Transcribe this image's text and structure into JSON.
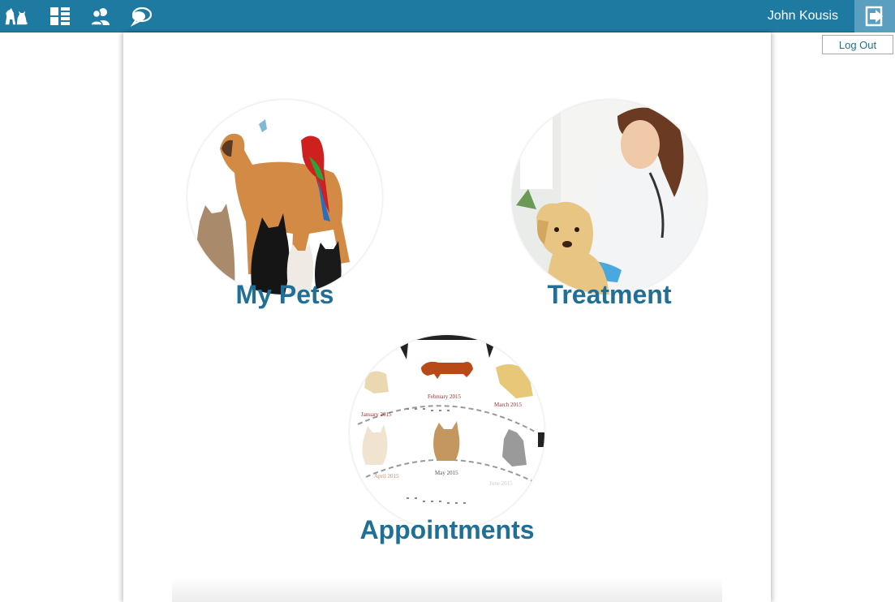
{
  "header": {
    "user_name": "John Kousis",
    "icons": [
      "pets-icon",
      "dashboard-icon",
      "contacts-icon",
      "chat-icon",
      "logout-icon"
    ],
    "accent_color": "#1f7aa1"
  },
  "logout_menu": {
    "label": "Log Out"
  },
  "tiles": [
    {
      "label": "My Pets"
    },
    {
      "label": "Treatment"
    },
    {
      "label": "Appointments"
    }
  ],
  "calendar_image": {
    "months": [
      "January 2015",
      "February 2015",
      "March 2015",
      "April 2015",
      "May 2015",
      "June 2015"
    ]
  }
}
